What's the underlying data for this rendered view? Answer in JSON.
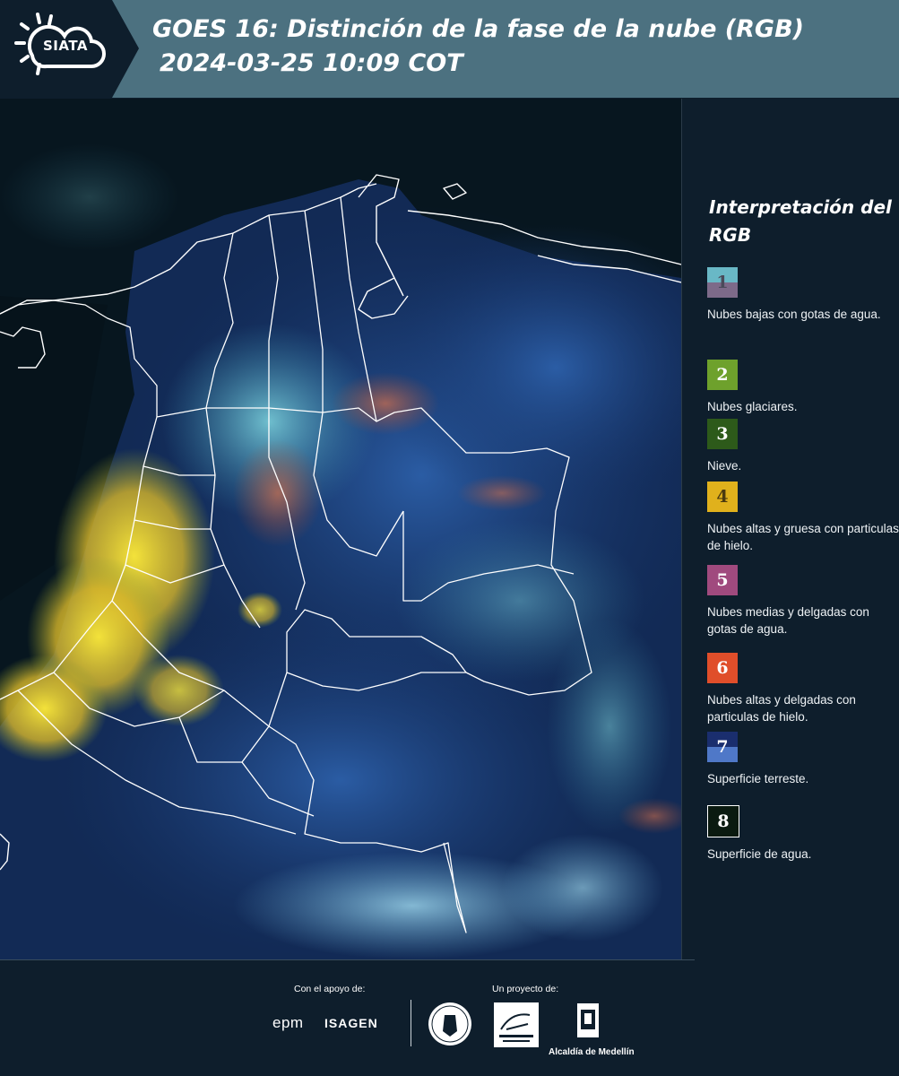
{
  "header": {
    "title_line1": "GOES 16: Distinción de la fase de la nube (RGB)",
    "title_line2": "2024-03-25 10:09 COT",
    "logo_text": "SIATA",
    "logo_icon": "sun-cloud-icon",
    "background_color": "#4c7180"
  },
  "map": {
    "description_icon": "satellite-rgb-image",
    "border_color": "#ffffff"
  },
  "legend": {
    "title": "Interpretación del RGB",
    "items": [
      {
        "number": "1",
        "label": "Nubes bajas con gotas de agua.",
        "color_top": "#69b8c6",
        "color_bottom": "#7d6a89"
      },
      {
        "number": "2",
        "label": "Nubes glaciares.",
        "color_top": "#6ea12c",
        "color_bottom": "#6ea12c"
      },
      {
        "number": "3",
        "label": "Nieve.",
        "color_top": "#2d5a1a",
        "color_bottom": "#2d5a1a"
      },
      {
        "number": "4",
        "label": "Nubes altas y gruesa con particulas de hielo.",
        "color_top": "#e0b11c",
        "color_bottom": "#e0b11c"
      },
      {
        "number": "5",
        "label": "Nubes medias y delgadas con gotas de agua.",
        "color_top": "#a04a7e",
        "color_bottom": "#a04a7e"
      },
      {
        "number": "6",
        "label": "Nubes altas y delgadas con particulas de hielo.",
        "color_top": "#e04e2a",
        "color_bottom": "#e04e2a"
      },
      {
        "number": "7",
        "label": "Superficie terreste.",
        "color_top": "#1a2e6e",
        "color_bottom": "#4f78c8"
      },
      {
        "number": "8",
        "label": "Superficie de agua.",
        "color_top": "#0a1a10",
        "color_bottom": "#0a1a10"
      }
    ]
  },
  "footer": {
    "support_label": "Con el apoyo de:",
    "project_label": "Un proyecto de:",
    "sponsor1": "epm",
    "sponsor2": "ISAGEN",
    "partner_alcaldia": "Alcaldía de Medellín"
  }
}
